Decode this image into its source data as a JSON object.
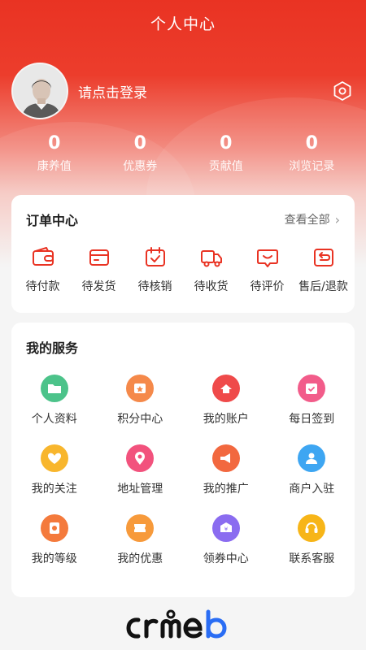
{
  "header": {
    "title": "个人中心"
  },
  "user": {
    "login_text": "请点击登录"
  },
  "stats": [
    {
      "value": "0",
      "label": "康养值"
    },
    {
      "value": "0",
      "label": "优惠券"
    },
    {
      "value": "0",
      "label": "贡献值"
    },
    {
      "value": "0",
      "label": "浏览记录"
    }
  ],
  "orders": {
    "title": "订单中心",
    "view_all": "查看全部",
    "items": [
      {
        "label": "待付款",
        "icon": "wallet-icon"
      },
      {
        "label": "待发货",
        "icon": "card-icon"
      },
      {
        "label": "待核销",
        "icon": "calendar-check-icon"
      },
      {
        "label": "待收货",
        "icon": "truck-icon"
      },
      {
        "label": "待评价",
        "icon": "comment-icon"
      },
      {
        "label": "售后/退款",
        "icon": "return-icon"
      }
    ]
  },
  "services": {
    "title": "我的服务",
    "items": [
      {
        "label": "个人资料",
        "icon": "folder-icon",
        "color": "#4cc38a"
      },
      {
        "label": "积分中心",
        "icon": "points-icon",
        "color": "#f5894a"
      },
      {
        "label": "我的账户",
        "icon": "account-icon",
        "color": "#ef4a4a"
      },
      {
        "label": "每日签到",
        "icon": "checkin-icon",
        "color": "#f25c8a"
      },
      {
        "label": "我的关注",
        "icon": "heart-icon",
        "color": "#f8b62d"
      },
      {
        "label": "地址管理",
        "icon": "location-icon",
        "color": "#f2527d"
      },
      {
        "label": "我的推广",
        "icon": "megaphone-icon",
        "color": "#f2683f"
      },
      {
        "label": "商户入驻",
        "icon": "merchant-icon",
        "color": "#3ea6f2"
      },
      {
        "label": "我的等级",
        "icon": "medal-icon",
        "color": "#f47a3c"
      },
      {
        "label": "我的优惠",
        "icon": "coupon-icon",
        "color": "#f79a3b"
      },
      {
        "label": "领券中心",
        "icon": "voucher-icon",
        "color": "#8a6cf0"
      },
      {
        "label": "联系客服",
        "icon": "headset-icon",
        "color": "#f7b518"
      }
    ]
  },
  "brand": {
    "logo_text": "crmeb"
  },
  "colors": {
    "primary": "#e93323",
    "text": "#333333",
    "background": "#f5f5f5"
  }
}
